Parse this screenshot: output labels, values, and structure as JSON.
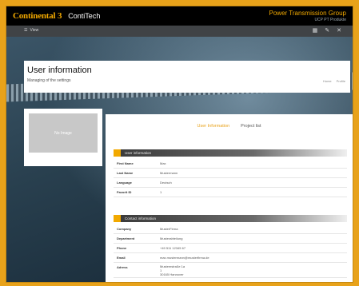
{
  "header": {
    "logo_continental": "Continental",
    "logo_mark": "3",
    "logo_contitech": "ContiTech",
    "brand_title": "Power Transmission Group",
    "brand_sub": "UCP PT Produkte"
  },
  "nav": {
    "view_label": "View",
    "icons": [
      "grid-icon",
      "pencil-icon",
      "close-icon"
    ]
  },
  "page": {
    "title": "User information",
    "subtitle": "Managing of the settings",
    "link_home": "Home",
    "link_profile": "Profile"
  },
  "avatar": {
    "label": "No Image"
  },
  "tabs": {
    "active": "User Information",
    "other": "Project list"
  },
  "user_section": {
    "title": "User information",
    "rows": [
      {
        "key": "First Name",
        "value": "Max"
      },
      {
        "key": "Last Name",
        "value": "Mustermann"
      },
      {
        "key": "Language",
        "value": "Deutsch"
      },
      {
        "key": "Favorit ID",
        "value": "1"
      }
    ]
  },
  "contact_section": {
    "title": "Contact information",
    "rows": [
      {
        "key": "Company",
        "value": "MusterFirma"
      },
      {
        "key": "Department",
        "value": "Musterabteilung"
      },
      {
        "key": "Phone",
        "value": "+49 511 12345 67"
      },
      {
        "key": "Email",
        "value": "max.mustermann@musterfirma.de"
      },
      {
        "key": "Adress",
        "value": "Mustemstraße 1a\n1\n30165 Hannover"
      }
    ]
  },
  "colors": {
    "accent": "#f2a900",
    "frame": "#e8a21a"
  }
}
